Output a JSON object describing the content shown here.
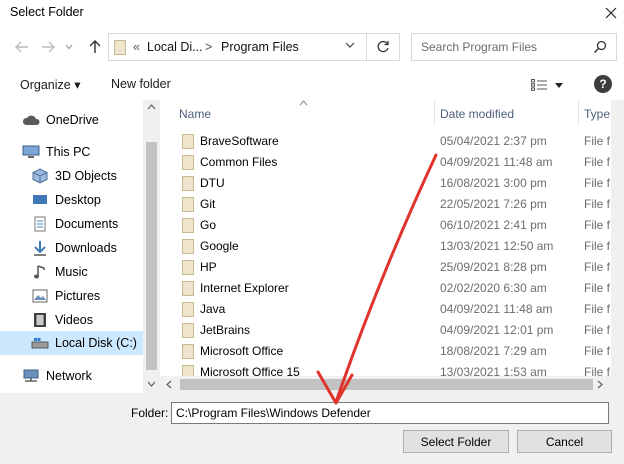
{
  "window": {
    "title": "Select Folder"
  },
  "navigation": {
    "address_segments": [
      "«",
      "Local Di...",
      ">",
      "Program Files"
    ],
    "search_placeholder": "Search Program Files"
  },
  "toolbar": {
    "organize": "Organize ▾",
    "new_folder": "New folder"
  },
  "sidebar": {
    "items": [
      {
        "label": "OneDrive",
        "icon": "cloud-icon"
      },
      {
        "label": "This PC",
        "icon": "computer-icon"
      },
      {
        "label": "3D Objects",
        "icon": "cube-icon"
      },
      {
        "label": "Desktop",
        "icon": "desktop-icon"
      },
      {
        "label": "Documents",
        "icon": "documents-icon"
      },
      {
        "label": "Downloads",
        "icon": "download-icon"
      },
      {
        "label": "Music",
        "icon": "music-icon"
      },
      {
        "label": "Pictures",
        "icon": "pictures-icon"
      },
      {
        "label": "Videos",
        "icon": "videos-icon"
      },
      {
        "label": "Local Disk (C:)",
        "icon": "drive-icon",
        "selected": true
      },
      {
        "label": "Network",
        "icon": "network-icon"
      }
    ]
  },
  "file_list": {
    "columns": [
      "Name",
      "Date modified",
      "Type"
    ],
    "rows": [
      {
        "name": "BraveSoftware",
        "date": "05/04/2021 2:37 pm",
        "type": "File f"
      },
      {
        "name": "Common Files",
        "date": "04/09/2021 11:48 am",
        "type": "File f"
      },
      {
        "name": "DTU",
        "date": "16/08/2021 3:00 pm",
        "type": "File f"
      },
      {
        "name": "Git",
        "date": "22/05/2021 7:26 pm",
        "type": "File f"
      },
      {
        "name": "Go",
        "date": "06/10/2021 2:41 pm",
        "type": "File f"
      },
      {
        "name": "Google",
        "date": "13/03/2021 12:50 am",
        "type": "File f"
      },
      {
        "name": "HP",
        "date": "25/09/2021 8:28 pm",
        "type": "File f"
      },
      {
        "name": "Internet Explorer",
        "date": "02/02/2020 6:30 am",
        "type": "File f"
      },
      {
        "name": "Java",
        "date": "04/09/2021 11:48 am",
        "type": "File f"
      },
      {
        "name": "JetBrains",
        "date": "04/09/2021 12:01 pm",
        "type": "File f"
      },
      {
        "name": "Microsoft Office",
        "date": "18/08/2021 7:29 am",
        "type": "File f"
      },
      {
        "name": "Microsoft Office 15",
        "date": "13/03/2021 1:53 am",
        "type": "File f"
      }
    ]
  },
  "footer": {
    "folder_label": "Folder:",
    "folder_value": "C:\\Program Files\\Windows Defender",
    "select_button": "Select Folder",
    "cancel_button": "Cancel"
  },
  "colors": {
    "annotation_arrow": "#e0332c",
    "selection": "#cce8ff",
    "folder": "#e8d7ad"
  }
}
